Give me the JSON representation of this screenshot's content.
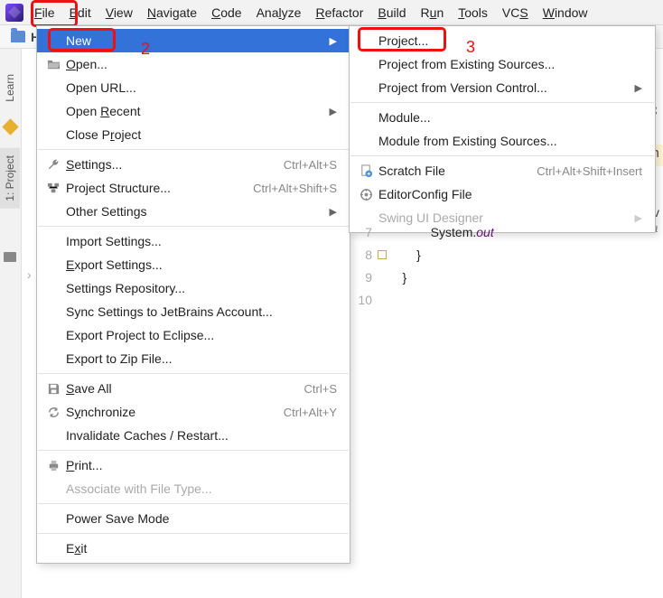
{
  "menubar": {
    "items": [
      "File",
      "Edit",
      "View",
      "Navigate",
      "Code",
      "Analyze",
      "Refactor",
      "Build",
      "Run",
      "Tools",
      "VCS",
      "Window"
    ],
    "underline_idx": [
      0,
      0,
      0,
      0,
      0,
      3,
      0,
      0,
      1,
      0,
      2,
      0
    ]
  },
  "toolbar": {
    "label": "H"
  },
  "sidebar": {
    "learn": "Learn",
    "project": "1: Project"
  },
  "file_menu": [
    {
      "type": "item",
      "icon": "",
      "label": "New",
      "shortcut": "",
      "arrow": true,
      "highlight": true
    },
    {
      "type": "item",
      "icon": "open",
      "label": "Open...",
      "shortcut": "",
      "ul": 0
    },
    {
      "type": "item",
      "icon": "",
      "label": "Open URL..."
    },
    {
      "type": "item",
      "icon": "",
      "label": "Open Recent",
      "arrow": true,
      "ul": 5
    },
    {
      "type": "item",
      "icon": "",
      "label": "Close Project",
      "ul": 7
    },
    {
      "type": "sep"
    },
    {
      "type": "item",
      "icon": "wrench",
      "label": "Settings...",
      "shortcut": "Ctrl+Alt+S",
      "ul": 0
    },
    {
      "type": "item",
      "icon": "structure",
      "label": "Project Structure...",
      "shortcut": "Ctrl+Alt+Shift+S"
    },
    {
      "type": "item",
      "icon": "",
      "label": "Other Settings",
      "arrow": true
    },
    {
      "type": "sep"
    },
    {
      "type": "item",
      "icon": "",
      "label": "Import Settings..."
    },
    {
      "type": "item",
      "icon": "",
      "label": "Export Settings...",
      "ul": 0
    },
    {
      "type": "item",
      "icon": "",
      "label": "Settings Repository..."
    },
    {
      "type": "item",
      "icon": "",
      "label": "Sync Settings to JetBrains Account..."
    },
    {
      "type": "item",
      "icon": "",
      "label": "Export Project to Eclipse..."
    },
    {
      "type": "item",
      "icon": "",
      "label": "Export to Zip File..."
    },
    {
      "type": "sep"
    },
    {
      "type": "item",
      "icon": "save",
      "label": "Save All",
      "shortcut": "Ctrl+S",
      "ul": 0
    },
    {
      "type": "item",
      "icon": "sync",
      "label": "Synchronize",
      "shortcut": "Ctrl+Alt+Y",
      "ul": 1
    },
    {
      "type": "item",
      "icon": "",
      "label": "Invalidate Caches / Restart..."
    },
    {
      "type": "sep"
    },
    {
      "type": "item",
      "icon": "print",
      "label": "Print...",
      "ul": 0
    },
    {
      "type": "item",
      "icon": "",
      "label": "Associate with File Type...",
      "disabled": true
    },
    {
      "type": "sep"
    },
    {
      "type": "item",
      "icon": "",
      "label": "Power Save Mode"
    },
    {
      "type": "sep"
    },
    {
      "type": "item",
      "icon": "",
      "label": "Exit",
      "ul": 1
    }
  ],
  "new_menu": [
    {
      "type": "item",
      "icon": "",
      "label": "Project..."
    },
    {
      "type": "item",
      "icon": "",
      "label": "Project from Existing Sources..."
    },
    {
      "type": "item",
      "icon": "",
      "label": "Project from Version Control...",
      "arrow": true
    },
    {
      "type": "sep"
    },
    {
      "type": "item",
      "icon": "",
      "label": "Module..."
    },
    {
      "type": "item",
      "icon": "",
      "label": "Module from Existing Sources..."
    },
    {
      "type": "sep"
    },
    {
      "type": "item",
      "icon": "scratch",
      "label": "Scratch File",
      "shortcut": "Ctrl+Alt+Shift+Insert"
    },
    {
      "type": "item",
      "icon": "editorconfig",
      "label": "EditorConfig File"
    },
    {
      "type": "item",
      "icon": "",
      "label": "Swing UI Designer",
      "arrow": true,
      "disabled": true
    }
  ],
  "annotations": {
    "a2": "2",
    "a3": "3"
  },
  "editor": {
    "lines": [
      {
        "n": 7,
        "mark": false,
        "code": "            System.out"
      },
      {
        "n": 8,
        "mark": true,
        "code": "        }"
      },
      {
        "n": 9,
        "mark": false,
        "code": "    }"
      },
      {
        "n": 10,
        "mark": false,
        "code": ""
      }
    ],
    "peek1": ";",
    "peek2": "n",
    "peek3": ".c v",
    "peek4": "ır a"
  }
}
